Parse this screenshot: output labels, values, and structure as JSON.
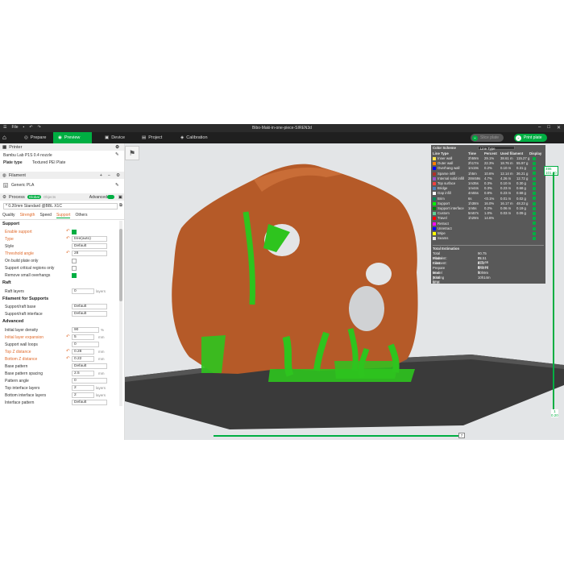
{
  "window": {
    "file_menu": "File",
    "title": "Bibo-Maki-in-one-piece-SIREN3d"
  },
  "tabs": [
    {
      "label": "Prepare"
    },
    {
      "label": "Preview"
    },
    {
      "label": "Device"
    },
    {
      "label": "Project"
    },
    {
      "label": "Calibration"
    }
  ],
  "actions": {
    "slice_plate": "Slice plate",
    "print_plate": "Print plate"
  },
  "printer": {
    "section": "Printer",
    "name": "Bambu Lab P1S 0.4 nozzle",
    "plate_type_label": "Plate type",
    "plate_type_value": "Textured PEI Plate"
  },
  "filament": {
    "section": "Filament",
    "item": "Generic PLA"
  },
  "process": {
    "section": "Process",
    "global": "Global",
    "objects": "Objects",
    "advanced": "Advanced",
    "preset": "* 0.20mm Standard @BBL X1C",
    "subtabs": [
      "Quality",
      "Strength",
      "Speed",
      "Support",
      "Others"
    ]
  },
  "support": {
    "group": "Support",
    "enable_label": "Enable support",
    "type_label": "Type",
    "type_value": "tree(auto)",
    "style_label": "Style",
    "style_value": "Default",
    "threshold_label": "Threshold angle",
    "threshold_value": "28",
    "build_plate_label": "On build plate only",
    "critical_label": "Support critical regions only",
    "remove_label": "Remove small overhangs"
  },
  "raft": {
    "group": "Raft",
    "layers_label": "Raft layers",
    "layers_value": "0",
    "layers_unit": "layers"
  },
  "filament_for_supports": {
    "group": "Filament for Supports",
    "base_label": "Support/raft base",
    "base_value": "Default",
    "interface_label": "Support/raft interface",
    "interface_value": "Default"
  },
  "advanced": {
    "group": "Advanced",
    "density_label": "Initial layer density",
    "density_value": "90",
    "density_unit": "%",
    "expansion_label": "Initial layer expansion",
    "expansion_value": "5",
    "expansion_unit": "mm",
    "wall_loops_label": "Support wall loops",
    "wall_loops_value": "0",
    "top_z_label": "Top Z distance",
    "top_z_value": "0.28",
    "top_z_unit": "mm",
    "bottom_z_label": "Bottom Z distance",
    "bottom_z_value": "0.22",
    "bottom_z_unit": "mm",
    "base_pattern_label": "Base pattern",
    "base_pattern_value": "Default",
    "base_spacing_label": "Base pattern spacing",
    "base_spacing_value": "2.5",
    "base_spacing_unit": "mm",
    "pattern_angle_label": "Pattern angle",
    "pattern_angle_value": "0",
    "top_iface_label": "Top interface layers",
    "top_iface_value": "2",
    "top_iface_unit": "layers",
    "bottom_iface_label": "Bottom interface layers",
    "bottom_iface_value": "2",
    "bottom_iface_unit": "layers",
    "iface_pattern_label": "Interface pattern",
    "iface_pattern_value": "Default"
  },
  "legend": {
    "color_scheme_label": "Color Scheme",
    "color_scheme_value": "Line Type",
    "headers": [
      "Line Type",
      "Time",
      "Percent",
      "Used filament",
      "Display"
    ],
    "rows": [
      {
        "name": "Inner wall",
        "time": "2h59m",
        "percent": "29.1%",
        "m": "38.61 m",
        "g": "115.27 g",
        "color": "#ffe54d"
      },
      {
        "name": "Outer wall",
        "time": "2h17m",
        "percent": "22.3%",
        "m": "18.76 m",
        "g": "55.97 g",
        "color": "#ff7f00"
      },
      {
        "name": "Overhang wall",
        "time": "1m19s",
        "percent": "0.2%",
        "m": "0.10 m",
        "g": "0.31 g",
        "color": "#0000ff"
      },
      {
        "name": "Sparse infill",
        "time": "1h5m",
        "percent": "10.6%",
        "m": "12.14 m",
        "g": "36.21 g",
        "color": "#b03029"
      },
      {
        "name": "Internal solid infill",
        "time": "28m59s",
        "percent": "4.7%",
        "m": "4.26 m",
        "g": "12.72 g",
        "color": "#9654cc"
      },
      {
        "name": "Top surface",
        "time": "1m35s",
        "percent": "0.3%",
        "m": "0.10 m",
        "g": "0.30 g",
        "color": "#f04040"
      },
      {
        "name": "Bridge",
        "time": "1m44s",
        "percent": "0.3%",
        "m": "0.23 m",
        "g": "0.68 g",
        "color": "#4d80ba"
      },
      {
        "name": "Gap infill",
        "time": "4m55s",
        "percent": "0.8%",
        "m": "0.23 m",
        "g": "0.68 g",
        "color": "#ffffff"
      },
      {
        "name": "Brim",
        "time": "6s",
        "percent": "<0.1%",
        "m": "0.01 m",
        "g": "0.02 g",
        "color": "#00875a"
      },
      {
        "name": "Support",
        "time": "1h38m",
        "percent": "16.0%",
        "m": "16.17 m",
        "g": "48.23 g",
        "color": "#00ff00"
      },
      {
        "name": "Support interface",
        "time": "1m5s",
        "percent": "0.2%",
        "m": "0.06 m",
        "g": "0.19 g",
        "color": "#008000"
      },
      {
        "name": "Custom",
        "time": "5m57s",
        "percent": "1.0%",
        "m": "0.03 m",
        "g": "0.09 g",
        "color": "#5ed194"
      },
      {
        "name": "Travel",
        "time": "1h29m",
        "percent": "14.6%",
        "m": "",
        "g": "",
        "color": "#ff0000"
      },
      {
        "name": "Retract",
        "time": "",
        "percent": "",
        "m": "",
        "g": "",
        "color": "#ff00ff"
      },
      {
        "name": "Unretract",
        "time": "",
        "percent": "",
        "m": "",
        "g": "",
        "color": "#0000ff"
      },
      {
        "name": "Wipe",
        "time": "",
        "percent": "",
        "m": "",
        "g": "",
        "color": "#ffff00"
      },
      {
        "name": "Seams",
        "time": "",
        "percent": "",
        "m": "",
        "g": "",
        "color": "#e6e6e6"
      }
    ],
    "total_estimation": "Total Estimation",
    "totals": [
      {
        "label": "Total Filament:",
        "value": "90.75 m   270.66 g"
      },
      {
        "label": "Model Filament:",
        "value": "74.51 m   222.24 g"
      },
      {
        "label": "Cost:",
        "value": "5.41"
      },
      {
        "label": "Prepare time:",
        "value": "5m47s"
      },
      {
        "label": "Model printing time:",
        "value": "10h9m"
      },
      {
        "label": "Total time:",
        "value": "10h14m"
      }
    ]
  },
  "layer_slider": {
    "top_layer": "496",
    "top_height": "101.20",
    "bottom_layer": "1",
    "bottom_height": "0.20"
  },
  "move_slider": {
    "value": "7"
  },
  "colors": {
    "accent": "#00ae42",
    "model": "#b85d2c",
    "support": "#33cc22",
    "bed": "#3c3c3c"
  }
}
